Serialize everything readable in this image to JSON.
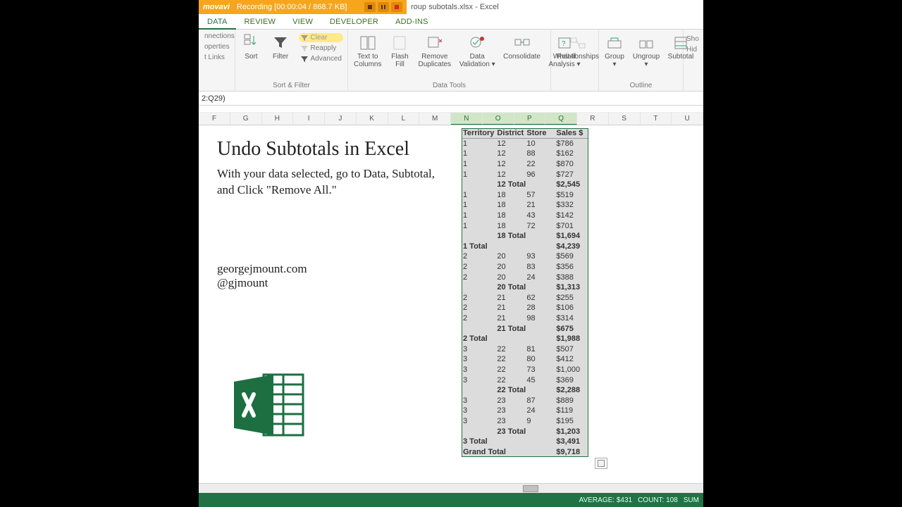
{
  "movavi": {
    "brand": "movavi",
    "status": "Recording",
    "time": "[00:00:04 / 868.7 KB]"
  },
  "window_title": "roup subotals.xlsx - Excel",
  "tabs": {
    "data": "DATA",
    "review": "REVIEW",
    "view": "VIEW",
    "developer": "DEVELOPER",
    "addins": "ADD-INS"
  },
  "ribbon": {
    "connections": {
      "line1": "nnections",
      "line2": "operties",
      "line3": "t Links"
    },
    "sort": "Sort",
    "filter": "Filter",
    "clear": "Clear",
    "reapply": "Reapply",
    "advanced": "Advanced",
    "group_sortfilter": "Sort & Filter",
    "text_to_columns": "Text to\nColumns",
    "flash_fill": "Flash\nFill",
    "remove_duplicates": "Remove\nDuplicates",
    "data_validation": "Data\nValidation ▾",
    "consolidate": "Consolidate",
    "whatif": "What-If\nAnalysis ▾",
    "relationships": "Relationships",
    "group_datatools": "Data Tools",
    "group_btn": "Group\n▾",
    "ungroup": "Ungroup\n▾",
    "subtotal_btn": "Subtotal",
    "group_outline": "Outline",
    "show": "Sho",
    "hide": "Hid"
  },
  "formula_bar": "2:Q29)",
  "columns": [
    "F",
    "G",
    "H",
    "I",
    "J",
    "K",
    "L",
    "M",
    "N",
    "O",
    "P",
    "Q",
    "R",
    "S",
    "T",
    "U"
  ],
  "sel_cols": [
    "N",
    "O",
    "P",
    "Q"
  ],
  "overlay": {
    "title": "Undo Subtotals in Excel",
    "body": "With your data selected, go to Data, Subtotal, and Click \"Remove All.\"",
    "site": "georgejmount.com",
    "handle": "@gjmount"
  },
  "table": {
    "headers": {
      "territory": "Territory",
      "district": "District",
      "store": "Store",
      "sales": "Sales $"
    },
    "rows": [
      {
        "t": "1",
        "d": "12",
        "s": "10",
        "v": "$786"
      },
      {
        "t": "1",
        "d": "12",
        "s": "88",
        "v": "$162"
      },
      {
        "t": "1",
        "d": "12",
        "s": "22",
        "v": "$870"
      },
      {
        "t": "1",
        "d": "12",
        "s": "96",
        "v": "$727"
      },
      {
        "t": "",
        "d": "",
        "s": "12 Total",
        "v": "$2,545",
        "bold": true
      },
      {
        "t": "1",
        "d": "18",
        "s": "57",
        "v": "$519"
      },
      {
        "t": "1",
        "d": "18",
        "s": "21",
        "v": "$332"
      },
      {
        "t": "1",
        "d": "18",
        "s": "43",
        "v": "$142"
      },
      {
        "t": "1",
        "d": "18",
        "s": "72",
        "v": "$701"
      },
      {
        "t": "",
        "d": "",
        "s": "18 Total",
        "v": "$1,694",
        "bold": true
      },
      {
        "t": "1 Total",
        "d": "",
        "s": "",
        "v": "$4,239",
        "bold": true
      },
      {
        "t": "2",
        "d": "20",
        "s": "93",
        "v": "$569"
      },
      {
        "t": "2",
        "d": "20",
        "s": "83",
        "v": "$356"
      },
      {
        "t": "2",
        "d": "20",
        "s": "24",
        "v": "$388"
      },
      {
        "t": "",
        "d": "",
        "s": "20 Total",
        "v": "$1,313",
        "bold": true
      },
      {
        "t": "2",
        "d": "21",
        "s": "62",
        "v": "$255"
      },
      {
        "t": "2",
        "d": "21",
        "s": "28",
        "v": "$106"
      },
      {
        "t": "2",
        "d": "21",
        "s": "98",
        "v": "$314"
      },
      {
        "t": "",
        "d": "",
        "s": "21 Total",
        "v": "$675",
        "bold": true
      },
      {
        "t": "2 Total",
        "d": "",
        "s": "",
        "v": "$1,988",
        "bold": true
      },
      {
        "t": "3",
        "d": "22",
        "s": "81",
        "v": "$507"
      },
      {
        "t": "3",
        "d": "22",
        "s": "80",
        "v": "$412"
      },
      {
        "t": "3",
        "d": "22",
        "s": "73",
        "v": "$1,000"
      },
      {
        "t": "3",
        "d": "22",
        "s": "45",
        "v": "$369"
      },
      {
        "t": "",
        "d": "",
        "s": "22 Total",
        "v": "$2,288",
        "bold": true
      },
      {
        "t": "3",
        "d": "23",
        "s": "87",
        "v": "$889"
      },
      {
        "t": "3",
        "d": "23",
        "s": "24",
        "v": "$119"
      },
      {
        "t": "3",
        "d": "23",
        "s": "9",
        "v": "$195"
      },
      {
        "t": "",
        "d": "",
        "s": "23 Total",
        "v": "$1,203",
        "bold": true
      },
      {
        "t": "3 Total",
        "d": "",
        "s": "",
        "v": "$3,491",
        "bold": true
      },
      {
        "t": "Grand Total",
        "d": "",
        "s": "",
        "v": "$9,718",
        "bold": true
      }
    ]
  },
  "status": {
    "average": "AVERAGE: $431",
    "count": "COUNT: 108",
    "sum": "SUM"
  }
}
